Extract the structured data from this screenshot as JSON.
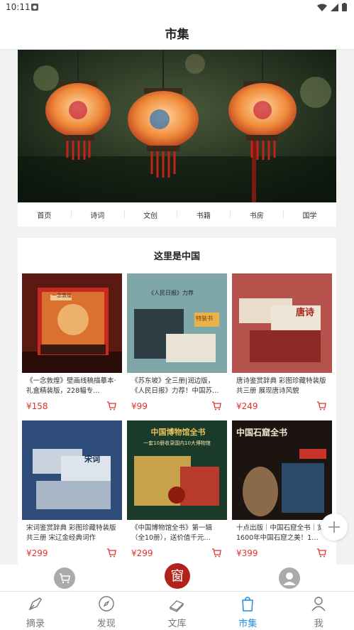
{
  "status": {
    "time": "10:11"
  },
  "header": {
    "title": "市集"
  },
  "categories": [
    "首页",
    "诗词",
    "文创",
    "书籍",
    "书房",
    "国学"
  ],
  "section": {
    "title": "这里是中国"
  },
  "products": [
    {
      "name": "《一念敦煌》壁画线稿描摹本·礼盒精装版，228幅专…",
      "price": "¥158"
    },
    {
      "name": "《苏东坡》全三册|润边版，《人民日报》力荐！中国苏…",
      "price": "¥99"
    },
    {
      "name": "唐诗鉴赏辞典 彩图珍藏特装版 共三册 展现唐诗风貌",
      "price": "¥249"
    },
    {
      "name": "宋词鉴赏辞典 彩图珍藏特装版 共三册 宋辽金经典词作",
      "price": "¥299"
    },
    {
      "name": "《中国博物馆全书》第一辑（全10册），送价值千元…",
      "price": "¥299"
    },
    {
      "name": "十点出版｜中国石窟全书｜览1600年中国石窟之美！1…",
      "price": "¥399"
    }
  ],
  "cover_text": {
    "c2_banner": "《人民日报》力荐",
    "c2_badge": "特装书",
    "c3_title": "唐诗",
    "c4_title": "宋词",
    "c5_title": "中国博物馆全书",
    "c5_sub": "一套10册收录国内10大博物馆",
    "c6_title": "中国石窟全书",
    "c1_title": "一念敦煌"
  },
  "center_logo": "窗",
  "tabs": [
    {
      "label": "摘录",
      "active": false
    },
    {
      "label": "发现",
      "active": false
    },
    {
      "label": "文库",
      "active": false
    },
    {
      "label": "市集",
      "active": true
    },
    {
      "label": "我",
      "active": false
    }
  ],
  "colors": {
    "accent": "#1a8fe6",
    "price": "#e0312a",
    "logo": "#b3211c"
  }
}
